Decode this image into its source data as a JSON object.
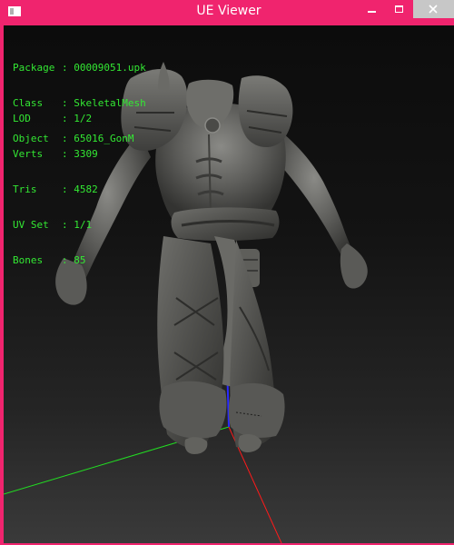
{
  "window": {
    "title": "UE Viewer"
  },
  "object_info": [
    {
      "key": "Package",
      "sep": ":",
      "value": "00009051.upk"
    },
    {
      "key": "Class",
      "sep": ":",
      "value": "SkeletalMesh"
    },
    {
      "key": "Object",
      "sep": ":",
      "value": "65016_GonM"
    }
  ],
  "mesh_info": [
    {
      "key": "LOD",
      "sep": ":",
      "value": "1/2"
    },
    {
      "key": "Verts",
      "sep": ":",
      "value": "3309"
    },
    {
      "key": "Tris",
      "sep": ":",
      "value": "4582"
    },
    {
      "key": "UV Set",
      "sep": ":",
      "value": "1/1"
    },
    {
      "key": "Bones",
      "sep": ":",
      "value": "85"
    }
  ],
  "colors": {
    "titlebar": "#f0246e",
    "info_text": "#33e833",
    "axis_x": "#ff1a1a",
    "axis_y": "#22dd22",
    "axis_z": "#2a2aff"
  },
  "model": {
    "name": "armor-skeletal-mesh"
  }
}
